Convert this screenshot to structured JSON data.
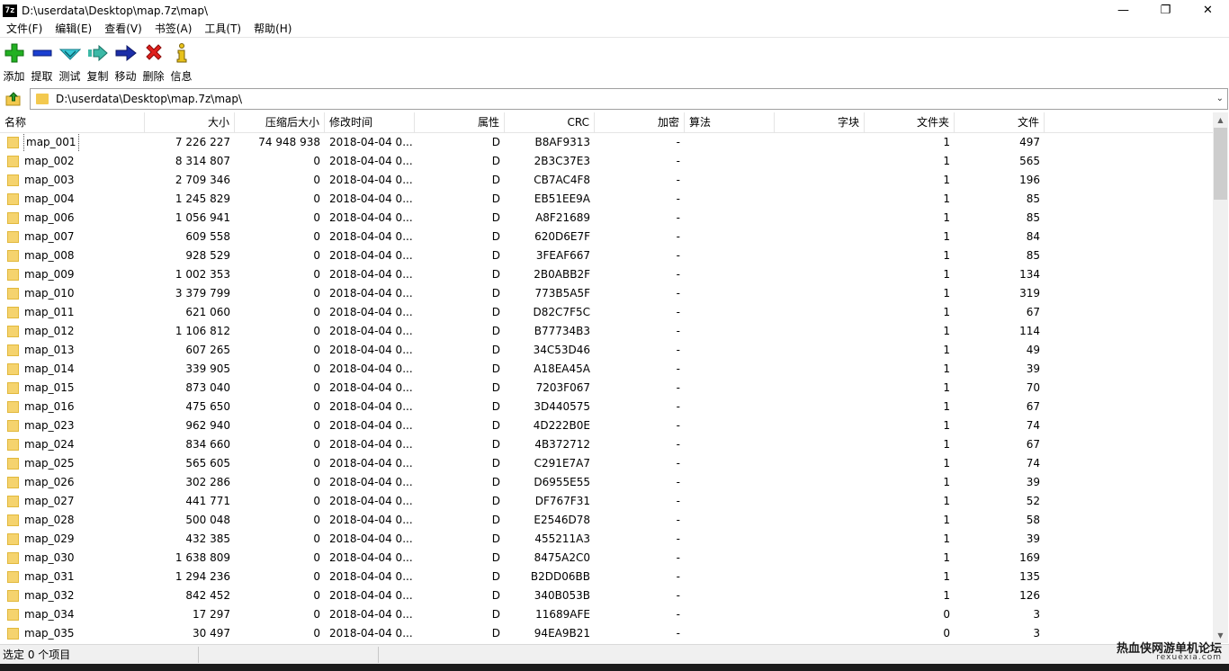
{
  "window": {
    "app_icon_text": "7z",
    "title": "D:\\userdata\\Desktop\\map.7z\\map\\",
    "minimize": "—",
    "maximize": "❐",
    "close": "✕"
  },
  "menu": [
    "文件(F)",
    "编辑(E)",
    "查看(V)",
    "书签(A)",
    "工具(T)",
    "帮助(H)"
  ],
  "toolbar": [
    {
      "label": "添加",
      "icon": "add-icon"
    },
    {
      "label": "提取",
      "icon": "extract-icon"
    },
    {
      "label": "测试",
      "icon": "test-icon"
    },
    {
      "label": "复制",
      "icon": "copy-icon"
    },
    {
      "label": "移动",
      "icon": "move-icon"
    },
    {
      "label": "删除",
      "icon": "delete-icon"
    },
    {
      "label": "信息",
      "icon": "info-icon"
    }
  ],
  "address": {
    "path": "D:\\userdata\\Desktop\\map.7z\\map\\"
  },
  "columns": {
    "name": "名称",
    "size": "大小",
    "packed": "压缩后大小",
    "mtime": "修改时间",
    "attr": "属性",
    "crc": "CRC",
    "enc": "加密",
    "method": "算法",
    "block": "字块",
    "folders": "文件夹",
    "files": "文件"
  },
  "rows": [
    {
      "name": "map_001",
      "size": "7 226 227",
      "packed": "74 948 938",
      "mtime": "2018-04-04 0...",
      "attr": "D",
      "crc": "B8AF9313",
      "enc": "-",
      "method": "",
      "block": "",
      "folders": "1",
      "files": "497"
    },
    {
      "name": "map_002",
      "size": "8 314 807",
      "packed": "0",
      "mtime": "2018-04-04 0...",
      "attr": "D",
      "crc": "2B3C37E3",
      "enc": "-",
      "method": "",
      "block": "",
      "folders": "1",
      "files": "565"
    },
    {
      "name": "map_003",
      "size": "2 709 346",
      "packed": "0",
      "mtime": "2018-04-04 0...",
      "attr": "D",
      "crc": "CB7AC4F8",
      "enc": "-",
      "method": "",
      "block": "",
      "folders": "1",
      "files": "196"
    },
    {
      "name": "map_004",
      "size": "1 245 829",
      "packed": "0",
      "mtime": "2018-04-04 0...",
      "attr": "D",
      "crc": "EB51EE9A",
      "enc": "-",
      "method": "",
      "block": "",
      "folders": "1",
      "files": "85"
    },
    {
      "name": "map_006",
      "size": "1 056 941",
      "packed": "0",
      "mtime": "2018-04-04 0...",
      "attr": "D",
      "crc": "A8F21689",
      "enc": "-",
      "method": "",
      "block": "",
      "folders": "1",
      "files": "85"
    },
    {
      "name": "map_007",
      "size": "609 558",
      "packed": "0",
      "mtime": "2018-04-04 0...",
      "attr": "D",
      "crc": "620D6E7F",
      "enc": "-",
      "method": "",
      "block": "",
      "folders": "1",
      "files": "84"
    },
    {
      "name": "map_008",
      "size": "928 529",
      "packed": "0",
      "mtime": "2018-04-04 0...",
      "attr": "D",
      "crc": "3FEAF667",
      "enc": "-",
      "method": "",
      "block": "",
      "folders": "1",
      "files": "85"
    },
    {
      "name": "map_009",
      "size": "1 002 353",
      "packed": "0",
      "mtime": "2018-04-04 0...",
      "attr": "D",
      "crc": "2B0ABB2F",
      "enc": "-",
      "method": "",
      "block": "",
      "folders": "1",
      "files": "134"
    },
    {
      "name": "map_010",
      "size": "3 379 799",
      "packed": "0",
      "mtime": "2018-04-04 0...",
      "attr": "D",
      "crc": "773B5A5F",
      "enc": "-",
      "method": "",
      "block": "",
      "folders": "1",
      "files": "319"
    },
    {
      "name": "map_011",
      "size": "621 060",
      "packed": "0",
      "mtime": "2018-04-04 0...",
      "attr": "D",
      "crc": "D82C7F5C",
      "enc": "-",
      "method": "",
      "block": "",
      "folders": "1",
      "files": "67"
    },
    {
      "name": "map_012",
      "size": "1 106 812",
      "packed": "0",
      "mtime": "2018-04-04 0...",
      "attr": "D",
      "crc": "B77734B3",
      "enc": "-",
      "method": "",
      "block": "",
      "folders": "1",
      "files": "114"
    },
    {
      "name": "map_013",
      "size": "607 265",
      "packed": "0",
      "mtime": "2018-04-04 0...",
      "attr": "D",
      "crc": "34C53D46",
      "enc": "-",
      "method": "",
      "block": "",
      "folders": "1",
      "files": "49"
    },
    {
      "name": "map_014",
      "size": "339 905",
      "packed": "0",
      "mtime": "2018-04-04 0...",
      "attr": "D",
      "crc": "A18EA45A",
      "enc": "-",
      "method": "",
      "block": "",
      "folders": "1",
      "files": "39"
    },
    {
      "name": "map_015",
      "size": "873 040",
      "packed": "0",
      "mtime": "2018-04-04 0...",
      "attr": "D",
      "crc": "7203F067",
      "enc": "-",
      "method": "",
      "block": "",
      "folders": "1",
      "files": "70"
    },
    {
      "name": "map_016",
      "size": "475 650",
      "packed": "0",
      "mtime": "2018-04-04 0...",
      "attr": "D",
      "crc": "3D440575",
      "enc": "-",
      "method": "",
      "block": "",
      "folders": "1",
      "files": "67"
    },
    {
      "name": "map_023",
      "size": "962 940",
      "packed": "0",
      "mtime": "2018-04-04 0...",
      "attr": "D",
      "crc": "4D222B0E",
      "enc": "-",
      "method": "",
      "block": "",
      "folders": "1",
      "files": "74"
    },
    {
      "name": "map_024",
      "size": "834 660",
      "packed": "0",
      "mtime": "2018-04-04 0...",
      "attr": "D",
      "crc": "4B372712",
      "enc": "-",
      "method": "",
      "block": "",
      "folders": "1",
      "files": "67"
    },
    {
      "name": "map_025",
      "size": "565 605",
      "packed": "0",
      "mtime": "2018-04-04 0...",
      "attr": "D",
      "crc": "C291E7A7",
      "enc": "-",
      "method": "",
      "block": "",
      "folders": "1",
      "files": "74"
    },
    {
      "name": "map_026",
      "size": "302 286",
      "packed": "0",
      "mtime": "2018-04-04 0...",
      "attr": "D",
      "crc": "D6955E55",
      "enc": "-",
      "method": "",
      "block": "",
      "folders": "1",
      "files": "39"
    },
    {
      "name": "map_027",
      "size": "441 771",
      "packed": "0",
      "mtime": "2018-04-04 0...",
      "attr": "D",
      "crc": "DF767F31",
      "enc": "-",
      "method": "",
      "block": "",
      "folders": "1",
      "files": "52"
    },
    {
      "name": "map_028",
      "size": "500 048",
      "packed": "0",
      "mtime": "2018-04-04 0...",
      "attr": "D",
      "crc": "E2546D78",
      "enc": "-",
      "method": "",
      "block": "",
      "folders": "1",
      "files": "58"
    },
    {
      "name": "map_029",
      "size": "432 385",
      "packed": "0",
      "mtime": "2018-04-04 0...",
      "attr": "D",
      "crc": "455211A3",
      "enc": "-",
      "method": "",
      "block": "",
      "folders": "1",
      "files": "39"
    },
    {
      "name": "map_030",
      "size": "1 638 809",
      "packed": "0",
      "mtime": "2018-04-04 0...",
      "attr": "D",
      "crc": "8475A2C0",
      "enc": "-",
      "method": "",
      "block": "",
      "folders": "1",
      "files": "169"
    },
    {
      "name": "map_031",
      "size": "1 294 236",
      "packed": "0",
      "mtime": "2018-04-04 0...",
      "attr": "D",
      "crc": "B2DD06BB",
      "enc": "-",
      "method": "",
      "block": "",
      "folders": "1",
      "files": "135"
    },
    {
      "name": "map_032",
      "size": "842 452",
      "packed": "0",
      "mtime": "2018-04-04 0...",
      "attr": "D",
      "crc": "340B053B",
      "enc": "-",
      "method": "",
      "block": "",
      "folders": "1",
      "files": "126"
    },
    {
      "name": "map_034",
      "size": "17 297",
      "packed": "0",
      "mtime": "2018-04-04 0...",
      "attr": "D",
      "crc": "11689AFE",
      "enc": "-",
      "method": "",
      "block": "",
      "folders": "0",
      "files": "3"
    },
    {
      "name": "map_035",
      "size": "30 497",
      "packed": "0",
      "mtime": "2018-04-04 0...",
      "attr": "D",
      "crc": "94EA9B21",
      "enc": "-",
      "method": "",
      "block": "",
      "folders": "0",
      "files": "3"
    }
  ],
  "status": {
    "selection": "选定 0 个项目"
  },
  "watermark": {
    "text": "热血侠网游单机论坛",
    "url": "rexuexia.com"
  }
}
